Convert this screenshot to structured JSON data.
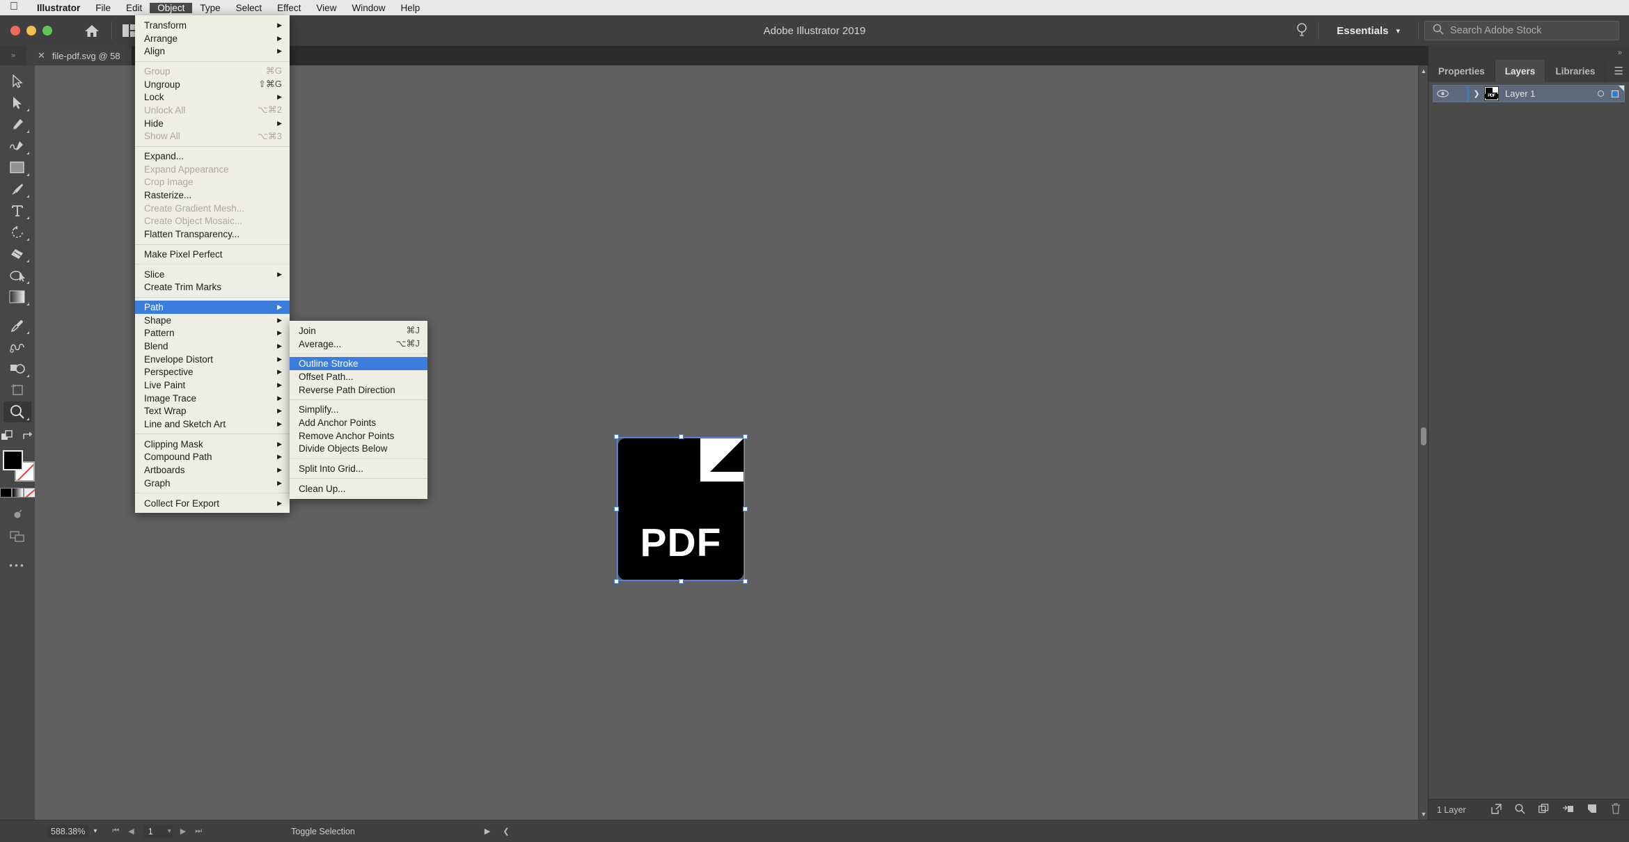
{
  "macbar": {
    "apple_icon": "apple-icon",
    "items": [
      {
        "label": "Illustrator",
        "bold": true,
        "active": false
      },
      {
        "label": "File",
        "bold": false,
        "active": false
      },
      {
        "label": "Edit",
        "bold": false,
        "active": false
      },
      {
        "label": "Object",
        "bold": false,
        "active": true
      },
      {
        "label": "Type",
        "bold": false,
        "active": false
      },
      {
        "label": "Select",
        "bold": false,
        "active": false
      },
      {
        "label": "Effect",
        "bold": false,
        "active": false
      },
      {
        "label": "View",
        "bold": false,
        "active": false
      },
      {
        "label": "Window",
        "bold": false,
        "active": false
      },
      {
        "label": "Help",
        "bold": false,
        "active": false
      }
    ]
  },
  "titlebar": {
    "app_title": "Adobe Illustrator 2019",
    "workspace": "Essentials",
    "search_placeholder": "Search Adobe Stock",
    "home_icon": "home-icon",
    "arrange_icon": "arrange-documents-icon",
    "chevron_icon": "chevron-down-icon",
    "bulb_icon": "lightbulb-icon",
    "search_icon": "search-icon"
  },
  "tabbar": {
    "collapse_icon": "collapse-panel-icon",
    "tab_close_icon": "close-icon",
    "tab_title": "file-pdf.svg @ 58"
  },
  "toolbar": {
    "tools": [
      {
        "name": "selection-tool",
        "glyph": "select"
      },
      {
        "name": "direct-selection-tool",
        "glyph": "direct"
      },
      {
        "name": "pen-tool",
        "glyph": "pen"
      },
      {
        "name": "curvature-tool",
        "glyph": "curvature"
      },
      {
        "name": "rectangle-tool",
        "glyph": "rect"
      },
      {
        "name": "paintbrush-tool",
        "glyph": "brush"
      },
      {
        "name": "type-tool",
        "glyph": "type"
      },
      {
        "name": "rotate-tool",
        "glyph": "rotate"
      },
      {
        "name": "eraser-tool",
        "glyph": "eraser"
      },
      {
        "name": "scale-tool",
        "glyph": "scale"
      },
      {
        "name": "gradient-tool",
        "glyph": "gradient"
      },
      {
        "name": "eyedropper-tool",
        "glyph": "eyedropper"
      },
      {
        "name": "blend-tool",
        "glyph": "blend"
      },
      {
        "name": "shape-builder-tool",
        "glyph": "shapebuilder"
      },
      {
        "name": "artboard-tool",
        "glyph": "artboard"
      },
      {
        "name": "zoom-tool",
        "glyph": "zoom"
      }
    ],
    "swap_icon": "swap-fill-stroke-icon",
    "default_icon": "default-fill-stroke-icon",
    "fill_color": "#000000",
    "stroke_color": "#ffffff",
    "more_tools_icon": "more-tools-icon",
    "screenmode_icon": "screen-mode-icon",
    "drawmode_icon": "draw-mode-icon"
  },
  "object_menu": {
    "title": "Object",
    "items": [
      {
        "label": "Transform",
        "shortcut": "",
        "submenu": true,
        "disabled": false,
        "highlight": false
      },
      {
        "label": "Arrange",
        "shortcut": "",
        "submenu": true,
        "disabled": false,
        "highlight": false
      },
      {
        "label": "Align",
        "shortcut": "",
        "submenu": true,
        "disabled": false,
        "highlight": false
      },
      {
        "sep": true
      },
      {
        "label": "Group",
        "shortcut": "⌘G",
        "submenu": false,
        "disabled": true,
        "highlight": false
      },
      {
        "label": "Ungroup",
        "shortcut": "⇧⌘G",
        "submenu": false,
        "disabled": false,
        "highlight": false
      },
      {
        "label": "Lock",
        "shortcut": "",
        "submenu": true,
        "disabled": false,
        "highlight": false
      },
      {
        "label": "Unlock All",
        "shortcut": "⌥⌘2",
        "submenu": false,
        "disabled": true,
        "highlight": false
      },
      {
        "label": "Hide",
        "shortcut": "",
        "submenu": true,
        "disabled": false,
        "highlight": false
      },
      {
        "label": "Show All",
        "shortcut": "⌥⌘3",
        "submenu": false,
        "disabled": true,
        "highlight": false
      },
      {
        "sep": true
      },
      {
        "label": "Expand...",
        "shortcut": "",
        "submenu": false,
        "disabled": false,
        "highlight": false
      },
      {
        "label": "Expand Appearance",
        "shortcut": "",
        "submenu": false,
        "disabled": true,
        "highlight": false
      },
      {
        "label": "Crop Image",
        "shortcut": "",
        "submenu": false,
        "disabled": true,
        "highlight": false
      },
      {
        "label": "Rasterize...",
        "shortcut": "",
        "submenu": false,
        "disabled": false,
        "highlight": false
      },
      {
        "label": "Create Gradient Mesh...",
        "shortcut": "",
        "submenu": false,
        "disabled": true,
        "highlight": false
      },
      {
        "label": "Create Object Mosaic...",
        "shortcut": "",
        "submenu": false,
        "disabled": true,
        "highlight": false
      },
      {
        "label": "Flatten Transparency...",
        "shortcut": "",
        "submenu": false,
        "disabled": false,
        "highlight": false
      },
      {
        "sep": true
      },
      {
        "label": "Make Pixel Perfect",
        "shortcut": "",
        "submenu": false,
        "disabled": false,
        "highlight": false
      },
      {
        "sep": true
      },
      {
        "label": "Slice",
        "shortcut": "",
        "submenu": true,
        "disabled": false,
        "highlight": false
      },
      {
        "label": "Create Trim Marks",
        "shortcut": "",
        "submenu": false,
        "disabled": false,
        "highlight": false
      },
      {
        "sep": true
      },
      {
        "label": "Path",
        "shortcut": "",
        "submenu": true,
        "disabled": false,
        "highlight": true
      },
      {
        "label": "Shape",
        "shortcut": "",
        "submenu": true,
        "disabled": false,
        "highlight": false
      },
      {
        "label": "Pattern",
        "shortcut": "",
        "submenu": true,
        "disabled": false,
        "highlight": false
      },
      {
        "label": "Blend",
        "shortcut": "",
        "submenu": true,
        "disabled": false,
        "highlight": false
      },
      {
        "label": "Envelope Distort",
        "shortcut": "",
        "submenu": true,
        "disabled": false,
        "highlight": false
      },
      {
        "label": "Perspective",
        "shortcut": "",
        "submenu": true,
        "disabled": false,
        "highlight": false
      },
      {
        "label": "Live Paint",
        "shortcut": "",
        "submenu": true,
        "disabled": false,
        "highlight": false
      },
      {
        "label": "Image Trace",
        "shortcut": "",
        "submenu": true,
        "disabled": false,
        "highlight": false
      },
      {
        "label": "Text Wrap",
        "shortcut": "",
        "submenu": true,
        "disabled": false,
        "highlight": false
      },
      {
        "label": "Line and Sketch Art",
        "shortcut": "",
        "submenu": true,
        "disabled": false,
        "highlight": false
      },
      {
        "sep": true
      },
      {
        "label": "Clipping Mask",
        "shortcut": "",
        "submenu": true,
        "disabled": false,
        "highlight": false
      },
      {
        "label": "Compound Path",
        "shortcut": "",
        "submenu": true,
        "disabled": false,
        "highlight": false
      },
      {
        "label": "Artboards",
        "shortcut": "",
        "submenu": true,
        "disabled": false,
        "highlight": false
      },
      {
        "label": "Graph",
        "shortcut": "",
        "submenu": true,
        "disabled": false,
        "highlight": false
      },
      {
        "sep": true
      },
      {
        "label": "Collect For Export",
        "shortcut": "",
        "submenu": true,
        "disabled": false,
        "highlight": false
      }
    ]
  },
  "path_menu": {
    "title": "Path",
    "items": [
      {
        "label": "Join",
        "shortcut": "⌘J",
        "submenu": false,
        "disabled": false,
        "highlight": false
      },
      {
        "label": "Average...",
        "shortcut": "⌥⌘J",
        "submenu": false,
        "disabled": false,
        "highlight": false
      },
      {
        "sep": true
      },
      {
        "label": "Outline Stroke",
        "shortcut": "",
        "submenu": false,
        "disabled": false,
        "highlight": true
      },
      {
        "label": "Offset Path...",
        "shortcut": "",
        "submenu": false,
        "disabled": false,
        "highlight": false
      },
      {
        "label": "Reverse Path Direction",
        "shortcut": "",
        "submenu": false,
        "disabled": false,
        "highlight": false
      },
      {
        "sep": true
      },
      {
        "label": "Simplify...",
        "shortcut": "",
        "submenu": false,
        "disabled": false,
        "highlight": false
      },
      {
        "label": "Add Anchor Points",
        "shortcut": "",
        "submenu": false,
        "disabled": false,
        "highlight": false
      },
      {
        "label": "Remove Anchor Points",
        "shortcut": "",
        "submenu": false,
        "disabled": false,
        "highlight": false
      },
      {
        "label": "Divide Objects Below",
        "shortcut": "",
        "submenu": false,
        "disabled": false,
        "highlight": false
      },
      {
        "sep": true
      },
      {
        "label": "Split Into Grid...",
        "shortcut": "",
        "submenu": false,
        "disabled": false,
        "highlight": false
      },
      {
        "sep": true
      },
      {
        "label": "Clean Up...",
        "shortcut": "",
        "submenu": false,
        "disabled": false,
        "highlight": false
      }
    ]
  },
  "canvas": {
    "artwork_label": "PDF",
    "artwork_name": "pdf-file-icon-artwork"
  },
  "dock": {
    "collapse_icon": "expand-panels-icon",
    "tabs": [
      {
        "label": "Properties",
        "active": false
      },
      {
        "label": "Layers",
        "active": true
      },
      {
        "label": "Libraries",
        "active": false
      }
    ],
    "menu_icon": "panel-menu-icon",
    "layer": {
      "name": "Layer 1",
      "eye_icon": "visibility-eye-icon",
      "expand_icon": "chevron-right-icon",
      "thumb_label": "PDF",
      "target_icon": "target-circle-icon",
      "select_icon": "selection-square-icon"
    },
    "footer": {
      "count_label": "1 Layer",
      "icons": [
        {
          "name": "locate-object-icon"
        },
        {
          "name": "search-layer-icon"
        },
        {
          "name": "new-sublayer-icon"
        },
        {
          "name": "make-clipping-mask-icon"
        },
        {
          "name": "new-layer-icon"
        },
        {
          "name": "delete-layer-icon"
        }
      ]
    }
  },
  "statusbar": {
    "zoom_level": "588.38%",
    "zoom_chevron_icon": "chevron-down-icon",
    "first_artboard_icon": "first-artboard-icon",
    "prev_artboard_icon": "previous-artboard-icon",
    "artboard_number": "1",
    "artboard_chevron_icon": "chevron-down-icon",
    "next_artboard_icon": "next-artboard-icon",
    "last_artboard_icon": "last-artboard-icon",
    "status_text": "Toggle Selection",
    "status_arrow_icon": "play-arrow-icon",
    "back_arrow_icon": "left-arrow-icon"
  }
}
